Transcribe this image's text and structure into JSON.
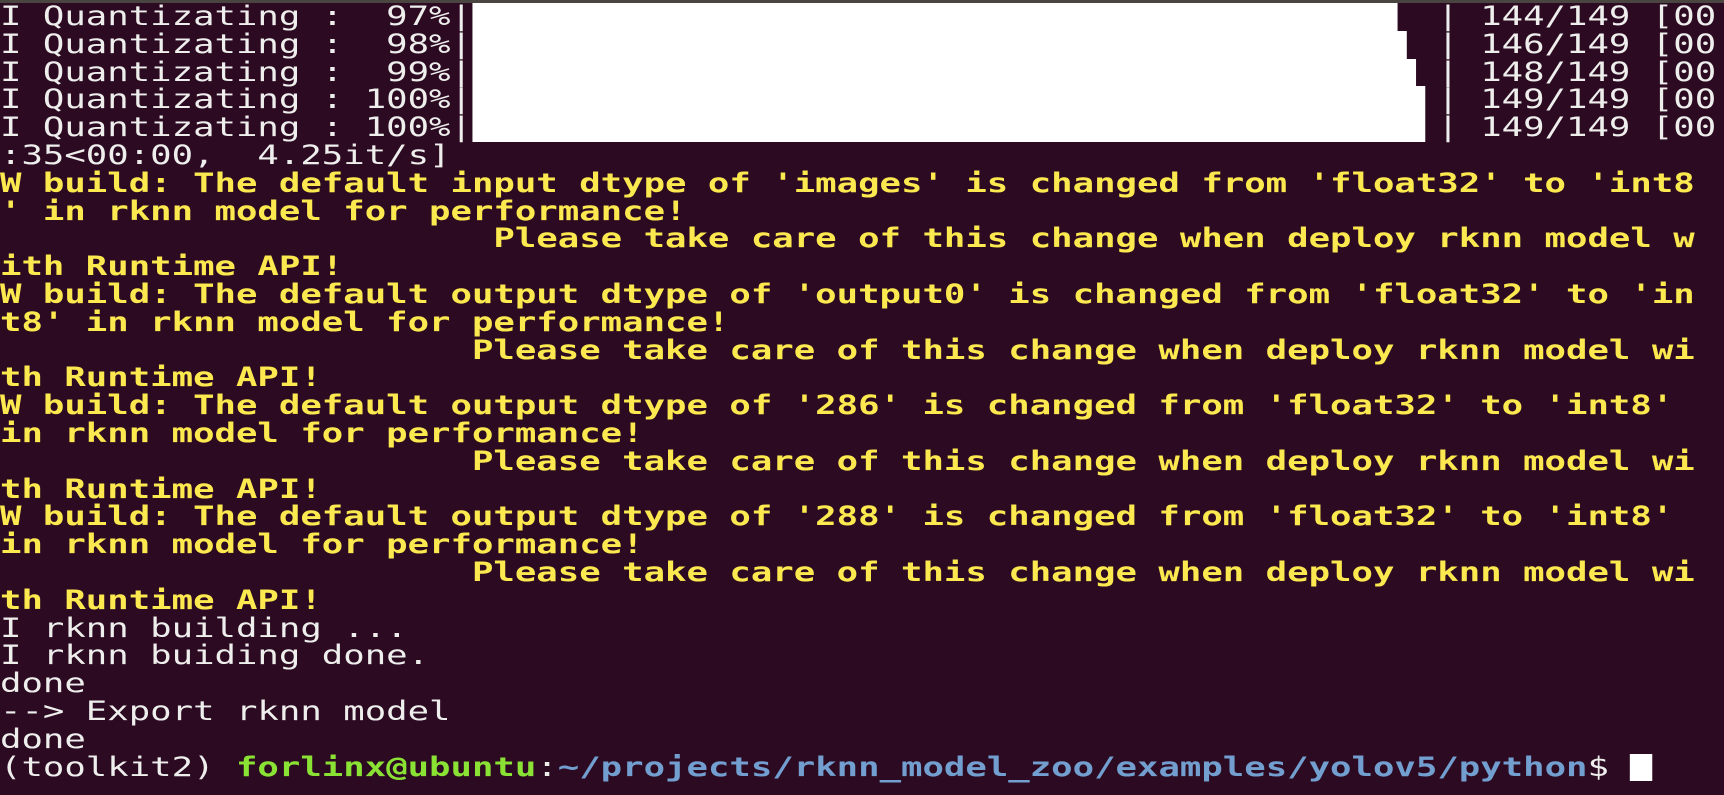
{
  "terminal": {
    "colors": {
      "background": "#2c0a22",
      "text": "#eeeeec",
      "warning": "#fce94f",
      "user_host": "#8ae234",
      "path": "#729fcf"
    },
    "progress": [
      {
        "prefix": "I Quantizating :  97%|",
        "percent": 97,
        "suffix": "| 144/149 [00"
      },
      {
        "prefix": "I Quantizating :  98%|",
        "percent": 98,
        "suffix": "| 146/149 [00"
      },
      {
        "prefix": "I Quantizating :  99%|",
        "percent": 99,
        "suffix": "| 148/149 [00"
      },
      {
        "prefix": "I Quantizating : 100%|",
        "percent": 100,
        "suffix": "| 149/149 [00"
      },
      {
        "prefix": "I Quantizating : 100%|",
        "percent": 100,
        "suffix": "| 149/149 [00"
      }
    ],
    "lines": [
      {
        "text": ":35<00:00,  4.25it/s]",
        "color": "white"
      },
      {
        "text": "W build: The default input dtype of 'images' is changed from 'float32' to 'int8",
        "color": "yellow"
      },
      {
        "text": "' in rknn model for performance!",
        "color": "yellow"
      },
      {
        "text": "                       Please take care of this change when deploy rknn model w",
        "color": "yellow"
      },
      {
        "text": "ith Runtime API!",
        "color": "yellow"
      },
      {
        "text": "W build: The default output dtype of 'output0' is changed from 'float32' to 'in",
        "color": "yellow"
      },
      {
        "text": "t8' in rknn model for performance!",
        "color": "yellow"
      },
      {
        "text": "                      Please take care of this change when deploy rknn model wi",
        "color": "yellow"
      },
      {
        "text": "th Runtime API!",
        "color": "yellow"
      },
      {
        "text": "W build: The default output dtype of '286' is changed from 'float32' to 'int8'",
        "color": "yellow"
      },
      {
        "text": "in rknn model for performance!",
        "color": "yellow"
      },
      {
        "text": "                      Please take care of this change when deploy rknn model wi",
        "color": "yellow"
      },
      {
        "text": "th Runtime API!",
        "color": "yellow"
      },
      {
        "text": "W build: The default output dtype of '288' is changed from 'float32' to 'int8'",
        "color": "yellow"
      },
      {
        "text": "in rknn model for performance!",
        "color": "yellow"
      },
      {
        "text": "                      Please take care of this change when deploy rknn model wi",
        "color": "yellow"
      },
      {
        "text": "th Runtime API!",
        "color": "yellow"
      },
      {
        "text": "I rknn building ...",
        "color": "white"
      },
      {
        "text": "I rknn buiding done.",
        "color": "white"
      },
      {
        "text": "done",
        "color": "white"
      },
      {
        "text": "--> Export rknn model",
        "color": "white"
      },
      {
        "text": "done",
        "color": "white"
      }
    ],
    "prompt": {
      "env": "(toolkit2) ",
      "user_host": "forlinx@ubuntu",
      "separator": ":",
      "path": "~/projects/rknn_model_zoo/examples/yolov5/python",
      "symbol": "$ "
    }
  }
}
